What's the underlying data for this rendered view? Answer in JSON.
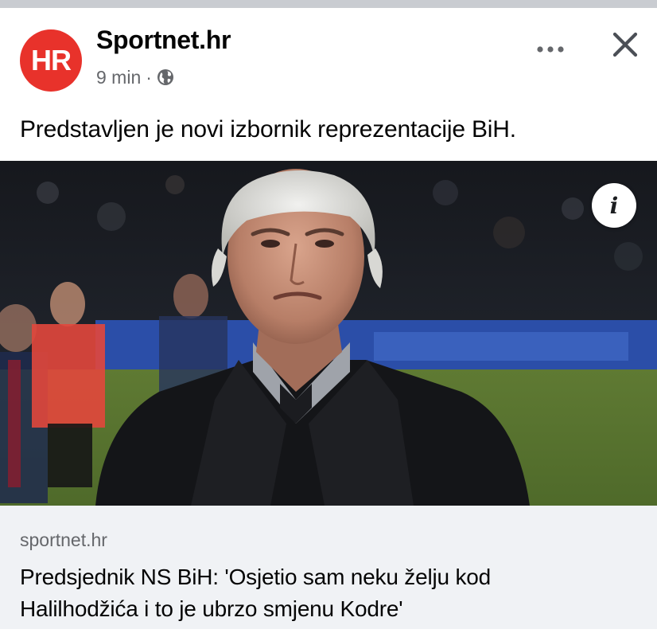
{
  "post": {
    "avatar_text": "HR",
    "page_name": "Sportnet.hr",
    "time": "9 min",
    "separator": "·",
    "privacy_icon": "globe-icon",
    "more_icon": "more-horizontal-icon",
    "close_icon": "close-icon",
    "text": "Predstavljen je novi izbornik reprezentacije BiH."
  },
  "photo": {
    "info_label": "i",
    "info_icon": "info-icon"
  },
  "link": {
    "domain": "sportnet.hr",
    "title_line1": "Predsjednik NS BiH: 'Osjetio sam neku želju kod",
    "title_line2": "Halilhodžića i to je ubrzo smjenu Kodre'"
  },
  "colors": {
    "avatar_bg": "#e8322b",
    "link_bg": "#f0f2f5",
    "secondary_text": "#65676b",
    "primary_text": "#050505"
  }
}
